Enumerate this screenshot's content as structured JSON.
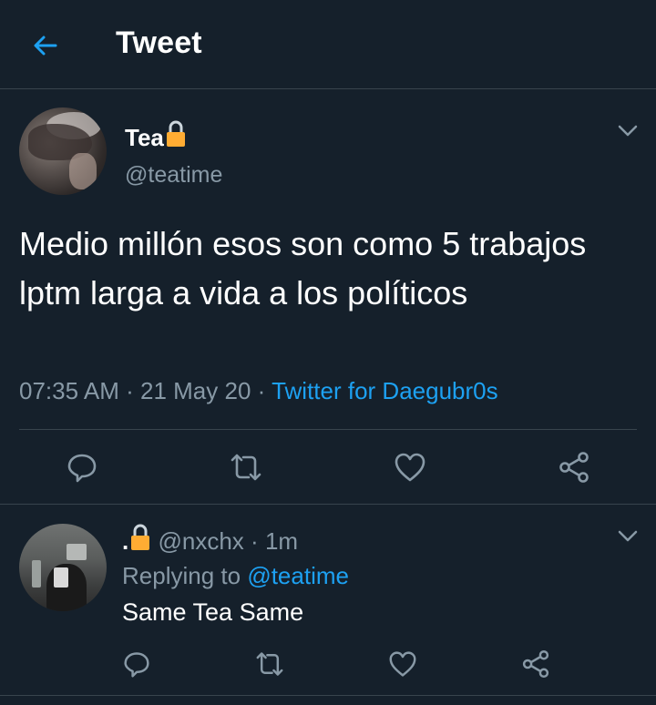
{
  "header": {
    "title": "Tweet",
    "back_icon": "arrow-left-icon",
    "accent": "#1da1f2"
  },
  "tweet": {
    "display_name": "Tea",
    "lock_icon": "lock-icon",
    "handle": "@teatime",
    "text": "Medio millón esos son como 5 trabajos lptm larga a vida a los políticos",
    "time": "07:35 AM",
    "date": "21 May 20",
    "source": "Twitter for Daegubr0s",
    "actions": [
      "reply-icon",
      "retweet-icon",
      "like-icon",
      "share-icon"
    ]
  },
  "reply": {
    "display_name": ".",
    "handle": "@nxchx",
    "time": "1m",
    "replying_label": "Replying to",
    "replying_to": "@teatime",
    "text": "Same Tea Same"
  },
  "colors": {
    "background": "#15202b",
    "border": "#38444d",
    "secondary_text": "#8899a6",
    "link": "#1da1f2",
    "lock_body": "#ffac33",
    "lock_shackle": "#ccd6dd"
  }
}
